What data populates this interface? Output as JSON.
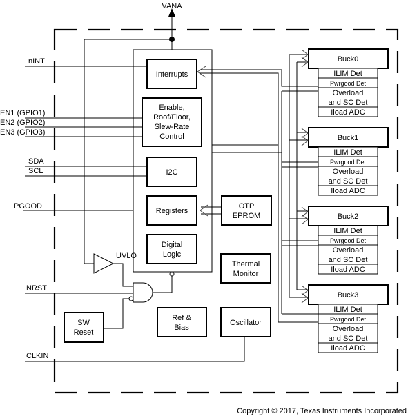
{
  "supply": {
    "label": "VANA"
  },
  "pins": {
    "nint": "nINT",
    "en1": "EN1 (GPIO1)",
    "en2": "EN2 (GPIO2)",
    "en3": "EN3 (GPIO3)",
    "sda": "SDA",
    "scl": "SCL",
    "pgood": "PGOOD",
    "nrst": "NRST",
    "clkin": "CLKIN"
  },
  "blocks": {
    "interrupts": "Interrupts",
    "enable": [
      "Enable,",
      "Roof/Floor,",
      "Slew-Rate",
      "Control"
    ],
    "i2c": "I2C",
    "registers": "Registers",
    "digital_logic": [
      "Digital",
      "Logic"
    ],
    "otp": [
      "OTP",
      "EPROM"
    ],
    "thermal": [
      "Thermal",
      "Monitor"
    ],
    "ref_bias": [
      "Ref &",
      "Bias"
    ],
    "oscillator": "Oscillator",
    "sw_reset": [
      "SW",
      "Reset"
    ],
    "uvlo": "UVLO"
  },
  "bucks": [
    {
      "name": "Buck0",
      "rows": [
        "ILIM Det",
        "Pwrgood Det",
        "Overload",
        "and SC Det",
        "Iload ADC"
      ]
    },
    {
      "name": "Buck1",
      "rows": [
        "ILIM Det",
        "Pwrgood Det",
        "Overload",
        "and SC Det",
        "Iload ADC"
      ]
    },
    {
      "name": "Buck2",
      "rows": [
        "ILIM Det",
        "Pwrgood Det",
        "Overload",
        "and SC Det",
        "Iload ADC"
      ]
    },
    {
      "name": "Buck3",
      "rows": [
        "ILIM Det",
        "Pwrgood Det",
        "Overload",
        "and SC Det",
        "Iload ADC"
      ]
    }
  ],
  "copyright": "Copyright © 2017, Texas Instruments Incorporated"
}
